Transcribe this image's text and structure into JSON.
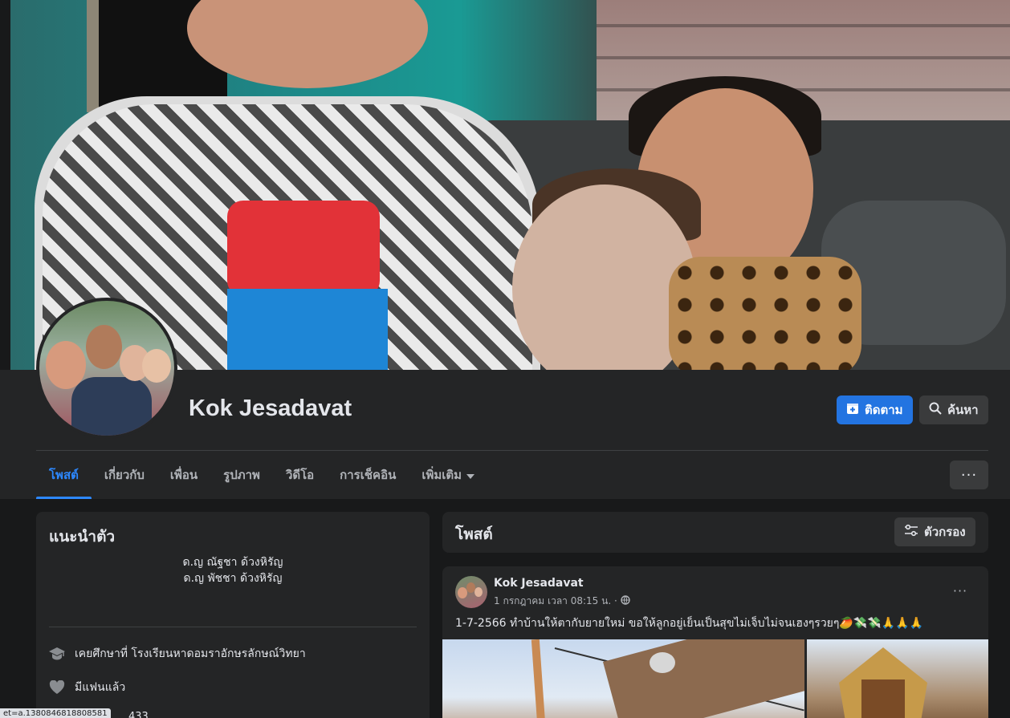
{
  "profile": {
    "name": "Kok Jesadavat"
  },
  "actions": {
    "follow_label": "ติดตาม",
    "search_label": "ค้นหา",
    "more_label": "···"
  },
  "tabs": [
    {
      "label": "โพสต์",
      "active": true
    },
    {
      "label": "เกี่ยวกับ"
    },
    {
      "label": "เพื่อน"
    },
    {
      "label": "รูปภาพ"
    },
    {
      "label": "วิดีโอ"
    },
    {
      "label": "การเช็คอิน"
    },
    {
      "label": "เพิ่มเติม"
    }
  ],
  "intro": {
    "title": "แนะนำตัว",
    "bio_line1": "ด.ญ ณัฐชา ด้วงหิรัญ",
    "bio_line2": "ด.ญ พัชชา ด้วงหิรัญ",
    "education": "เคยศึกษาที่ โรงเรียนหาดอมราอักษรลักษณ์วิทยา",
    "relationship": "มีแฟนแล้ว",
    "partial_number": "433"
  },
  "posts_section": {
    "title": "โพสต์",
    "filter_label": "ตัวกรอง"
  },
  "post": {
    "author": "Kok Jesadavat",
    "timestamp": "1 กรกฎาคม เวลา 08:15 น. ·",
    "text": "1-7-2566 ทำบ้านให้ตากับยายใหม่ ขอให้ลูกอยู่เย็นเป็นสุขไม่เจ็บไม่จนเฮงๆรวยๆ🥭💸💸🙏🙏🙏"
  },
  "statusbar": {
    "url": "et=a.1380846818808581"
  },
  "colors": {
    "background": "#18191a",
    "card": "#242526",
    "accent": "#2374e1",
    "active_tab": "#2d88ff"
  }
}
